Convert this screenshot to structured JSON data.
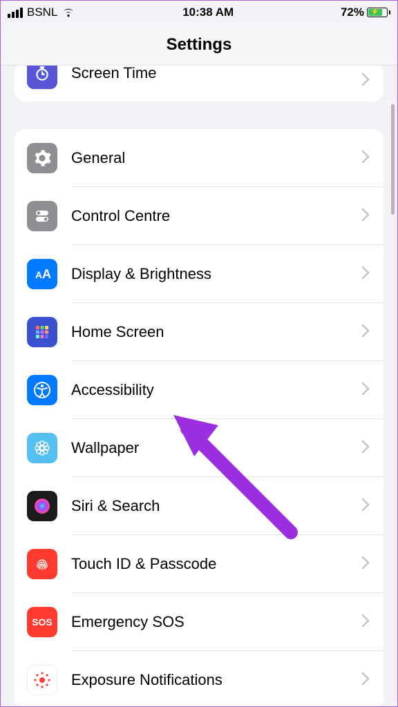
{
  "status": {
    "carrier": "BSNL",
    "time": "10:38 AM",
    "battery_pct": "72%"
  },
  "nav": {
    "title": "Settings"
  },
  "group1": {
    "screen_time": "Screen Time"
  },
  "group2": {
    "general": "General",
    "control_centre": "Control Centre",
    "display": "Display & Brightness",
    "home_screen": "Home Screen",
    "accessibility": "Accessibility",
    "wallpaper": "Wallpaper",
    "siri": "Siri & Search",
    "touch_id": "Touch ID & Passcode",
    "sos": "Emergency SOS",
    "sos_icon": "SOS",
    "exposure": "Exposure Notifications"
  }
}
